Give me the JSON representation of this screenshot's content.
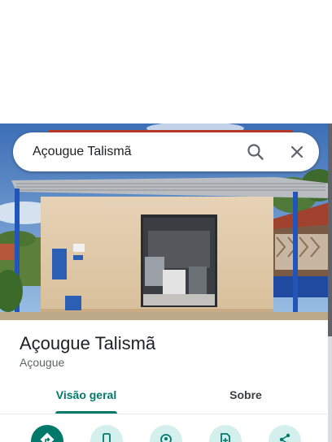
{
  "search": {
    "query": "Açougue Talismã"
  },
  "place": {
    "name": "Açougue Talismã",
    "category": "Açougue"
  },
  "tabs": [
    {
      "label": "Visão geral",
      "selected": true
    },
    {
      "label": "Sobre",
      "selected": false
    }
  ],
  "actions": [
    {
      "icon": "directions-icon"
    },
    {
      "icon": "phone-icon"
    },
    {
      "icon": "map-pin-icon"
    },
    {
      "icon": "save-icon"
    },
    {
      "icon": "share-icon"
    }
  ],
  "colors": {
    "accent": "#00796b",
    "action_bg": "#d3f0ec",
    "title_text": "#202124",
    "secondary_text": "#5f6368"
  }
}
